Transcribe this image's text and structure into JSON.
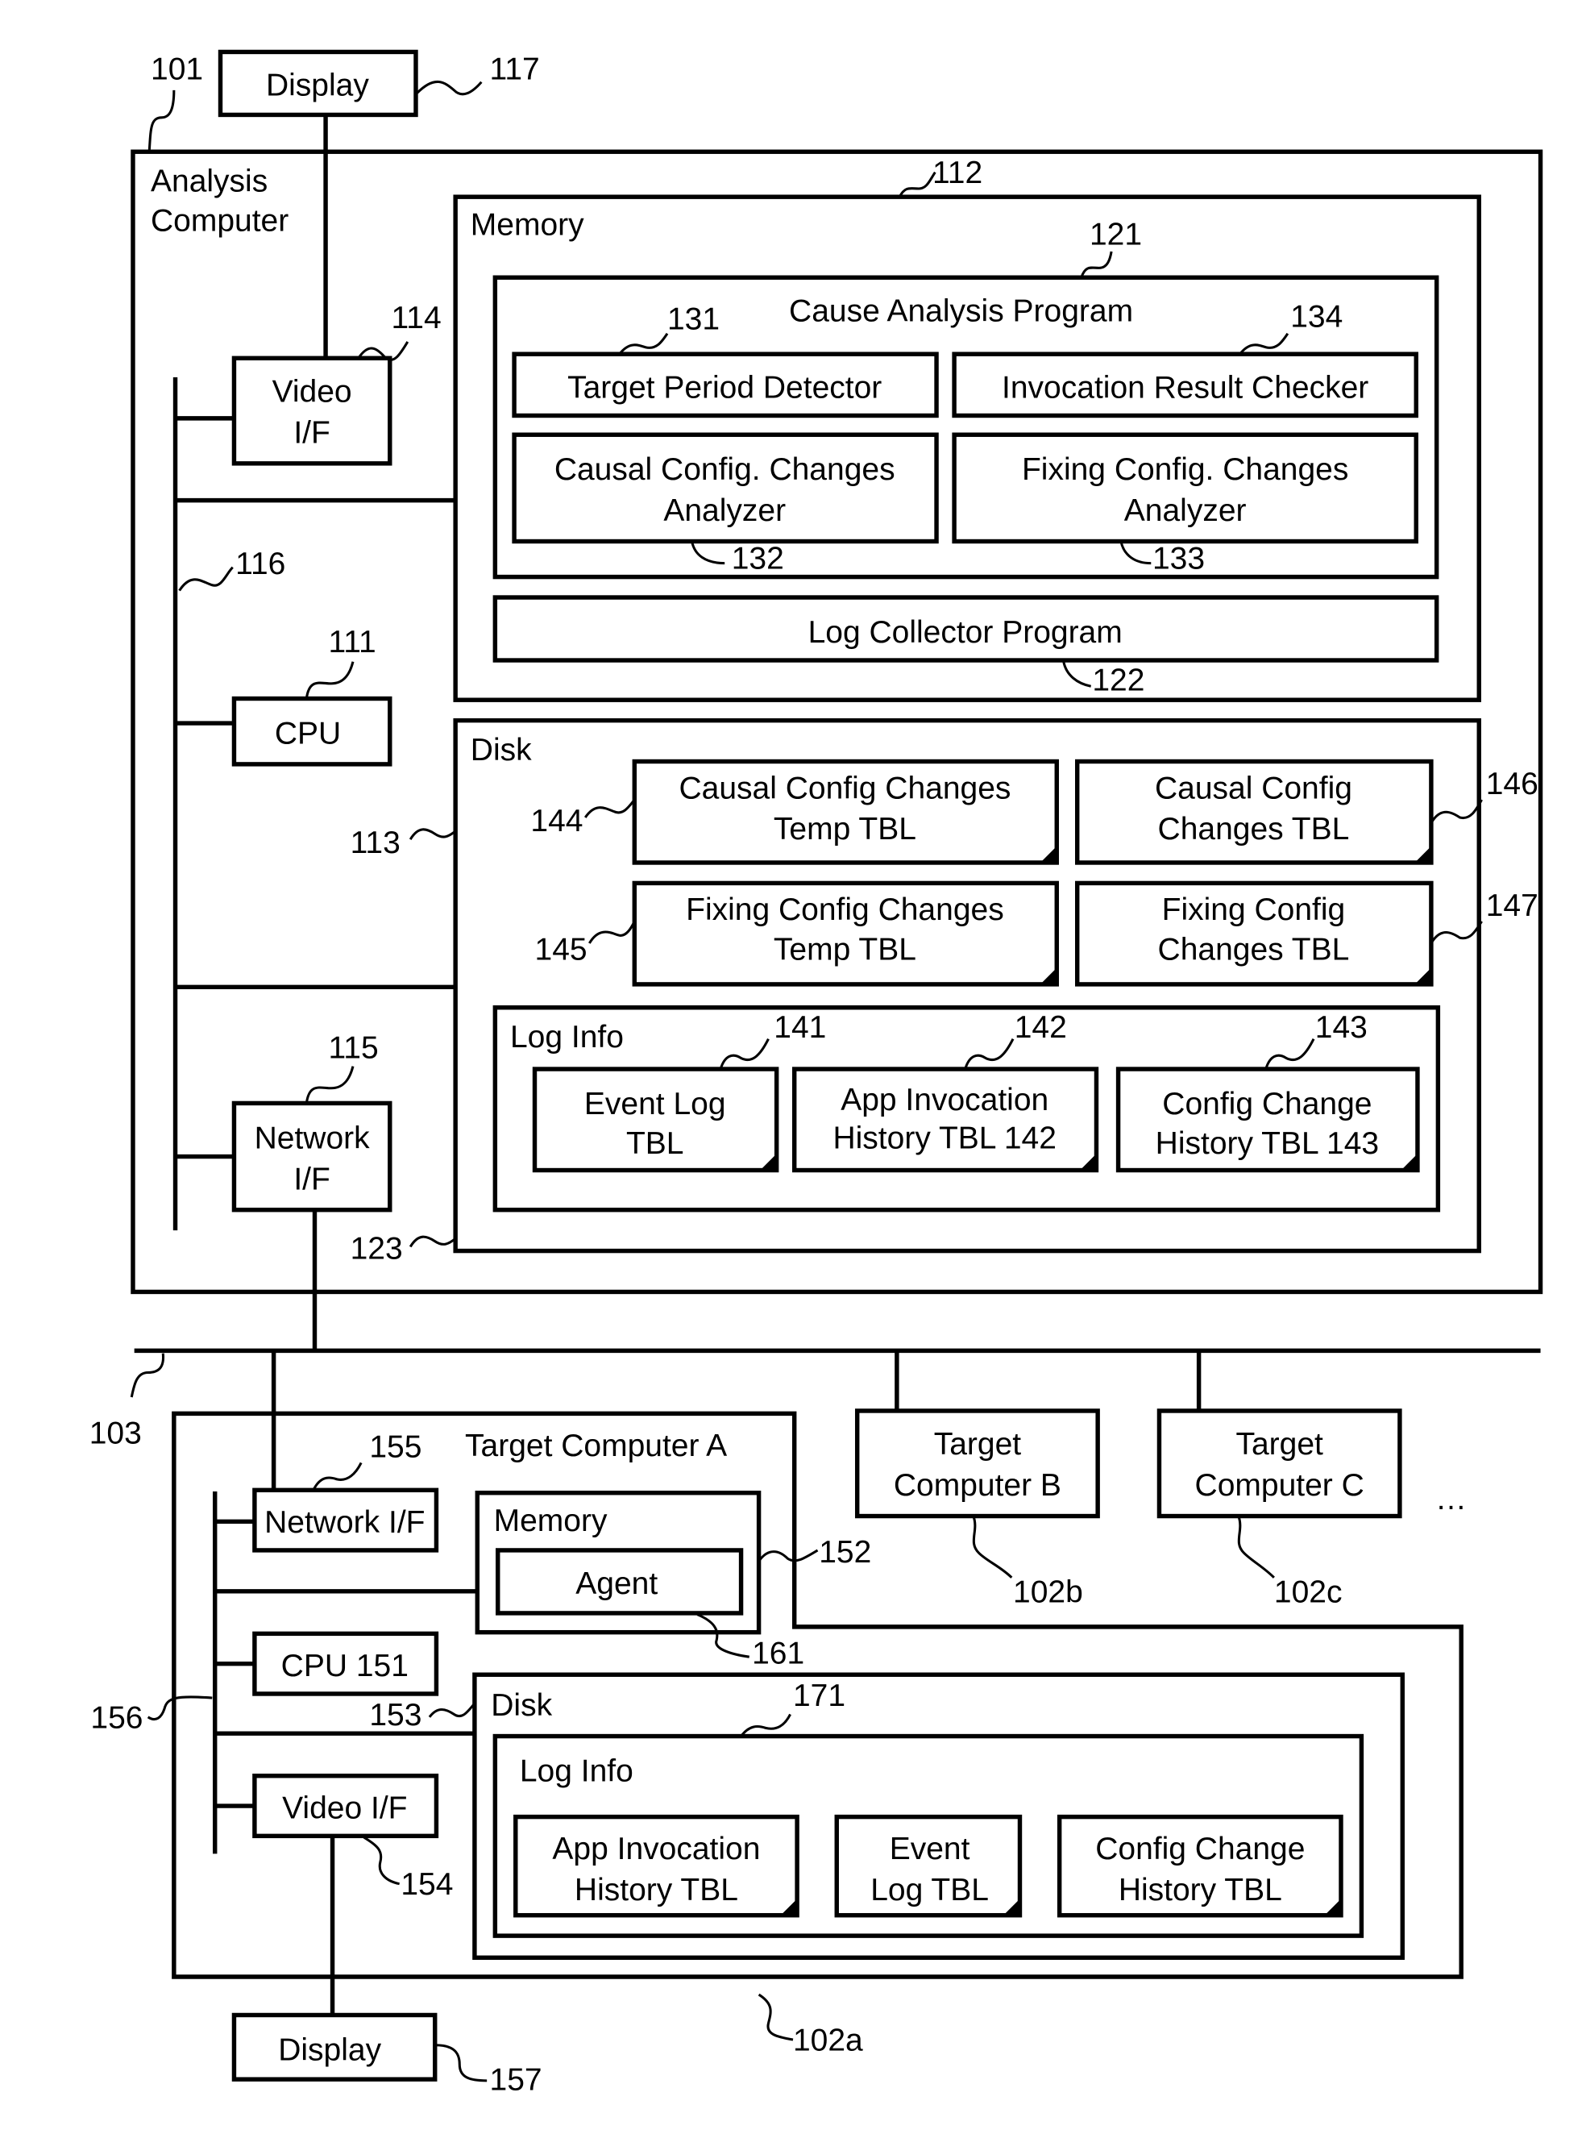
{
  "analysis_computer": {
    "title_line1": "Analysis",
    "title_line2": "Computer",
    "ref": "101",
    "display": {
      "label": "Display",
      "ref": "117"
    },
    "video_if": {
      "line1": "Video",
      "line2": "I/F",
      "ref": "114"
    },
    "bus_ref": "116",
    "cpu": {
      "label": "CPU",
      "ref": "111"
    },
    "network_if": {
      "line1": "Network",
      "line2": "I/F",
      "ref": "115"
    },
    "memory": {
      "label": "Memory",
      "ref": "112",
      "cause_analysis_program": {
        "label": "Cause Analysis Program",
        "ref": "121",
        "target_period_detector": {
          "label": "Target Period Detector",
          "ref": "131"
        },
        "invocation_result_checker": {
          "label": "Invocation Result Checker",
          "ref": "134"
        },
        "causal_analyzer": {
          "line1": "Causal Config. Changes",
          "line2": "Analyzer",
          "ref": "132"
        },
        "fixing_analyzer": {
          "line1": "Fixing Config. Changes",
          "line2": "Analyzer",
          "ref": "133"
        }
      },
      "log_collector": {
        "label": "Log Collector Program",
        "ref": "122"
      }
    },
    "disk": {
      "label": "Disk",
      "ref": "113",
      "causal_temp_tbl": {
        "line1": "Causal Config Changes",
        "line2": "Temp TBL",
        "ref": "144"
      },
      "causal_tbl": {
        "line1": "Causal Config",
        "line2": "Changes TBL",
        "ref": "146"
      },
      "fixing_temp_tbl": {
        "line1": "Fixing Config Changes",
        "line2": "Temp TBL",
        "ref": "145"
      },
      "fixing_tbl": {
        "line1": "Fixing Config",
        "line2": "Changes TBL",
        "ref": "147"
      },
      "log_info": {
        "label": "Log Info",
        "ref": "123",
        "event_log": {
          "line1": "Event Log",
          "line2": "TBL",
          "ref": "141"
        },
        "app_invocation": {
          "line1": "App Invocation",
          "line2": "History TBL 142",
          "ref": "142"
        },
        "config_change": {
          "line1": "Config Change",
          "line2": "History TBL 143",
          "ref": "143"
        }
      }
    }
  },
  "network_ref": "103",
  "target_b": {
    "line1": "Target",
    "line2": "Computer B",
    "ref": "102b"
  },
  "target_c": {
    "line1": "Target",
    "line2": "Computer C",
    "ref": "102c"
  },
  "ellipsis": "…",
  "target_a": {
    "title": "Target Computer A",
    "ref": "102a",
    "network_if": {
      "label": "Network I/F",
      "ref": "155"
    },
    "memory": {
      "label": "Memory",
      "ref": "152",
      "agent": {
        "label": "Agent",
        "ref": "161"
      }
    },
    "cpu": {
      "label": "CPU 151"
    },
    "bus_ref": "156",
    "video_if": {
      "label": "Video I/F",
      "ref": "154"
    },
    "display": {
      "label": "Display",
      "ref": "157"
    },
    "disk": {
      "label": "Disk",
      "ref": "153",
      "log_info": {
        "label": "Log Info",
        "ref": "171",
        "app_invocation": {
          "line1": "App Invocation",
          "line2": "History TBL"
        },
        "event_log": {
          "line1": "Event",
          "line2": "Log TBL"
        },
        "config_change": {
          "line1": "Config Change",
          "line2": "History TBL"
        }
      }
    }
  }
}
